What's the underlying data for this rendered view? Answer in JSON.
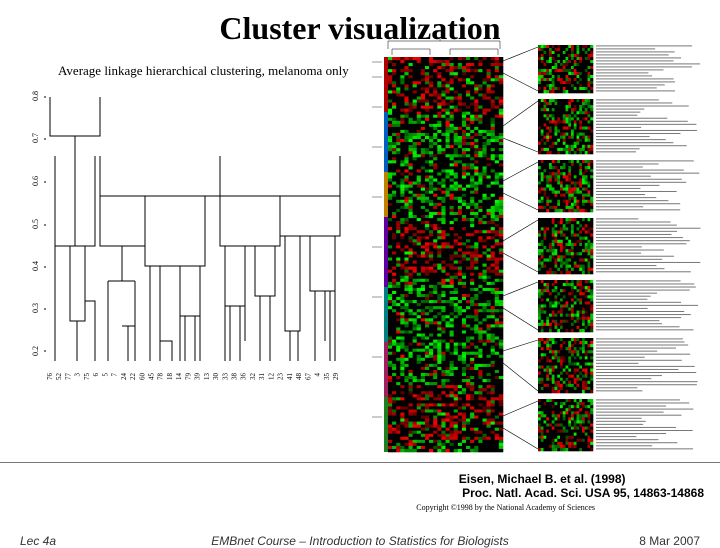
{
  "title": "Cluster visualization",
  "dendrogram": {
    "caption": "Average linkage hierarchical clustering, melanoma only",
    "yticks": [
      "0.8",
      "0.7",
      "0.6",
      "0.5",
      "0.4",
      "0.3",
      "0.2"
    ],
    "leaf_labels": [
      "76",
      "52",
      "77",
      "3",
      "75",
      "6",
      "5",
      "7",
      "24",
      "22",
      "60",
      "45",
      "78",
      "18",
      "14",
      "79",
      "39",
      "13",
      "30",
      "33",
      "38",
      "36",
      "32",
      "31",
      "12",
      "23",
      "41",
      "48",
      "67",
      "4",
      "35",
      "29"
    ]
  },
  "citation": {
    "line1": "Eisen, Michael B. et al. (1998)",
    "line2": "Proc. Natl. Acad. Sci. USA 95, 14863-14868",
    "copyright": "Copyright ©1998 by the National Academy of Sciences"
  },
  "footer": {
    "left": "Lec 4a",
    "center": "EMBnet Course – Introduction to Statistics for Biologists",
    "right": "8 Mar 2007"
  }
}
